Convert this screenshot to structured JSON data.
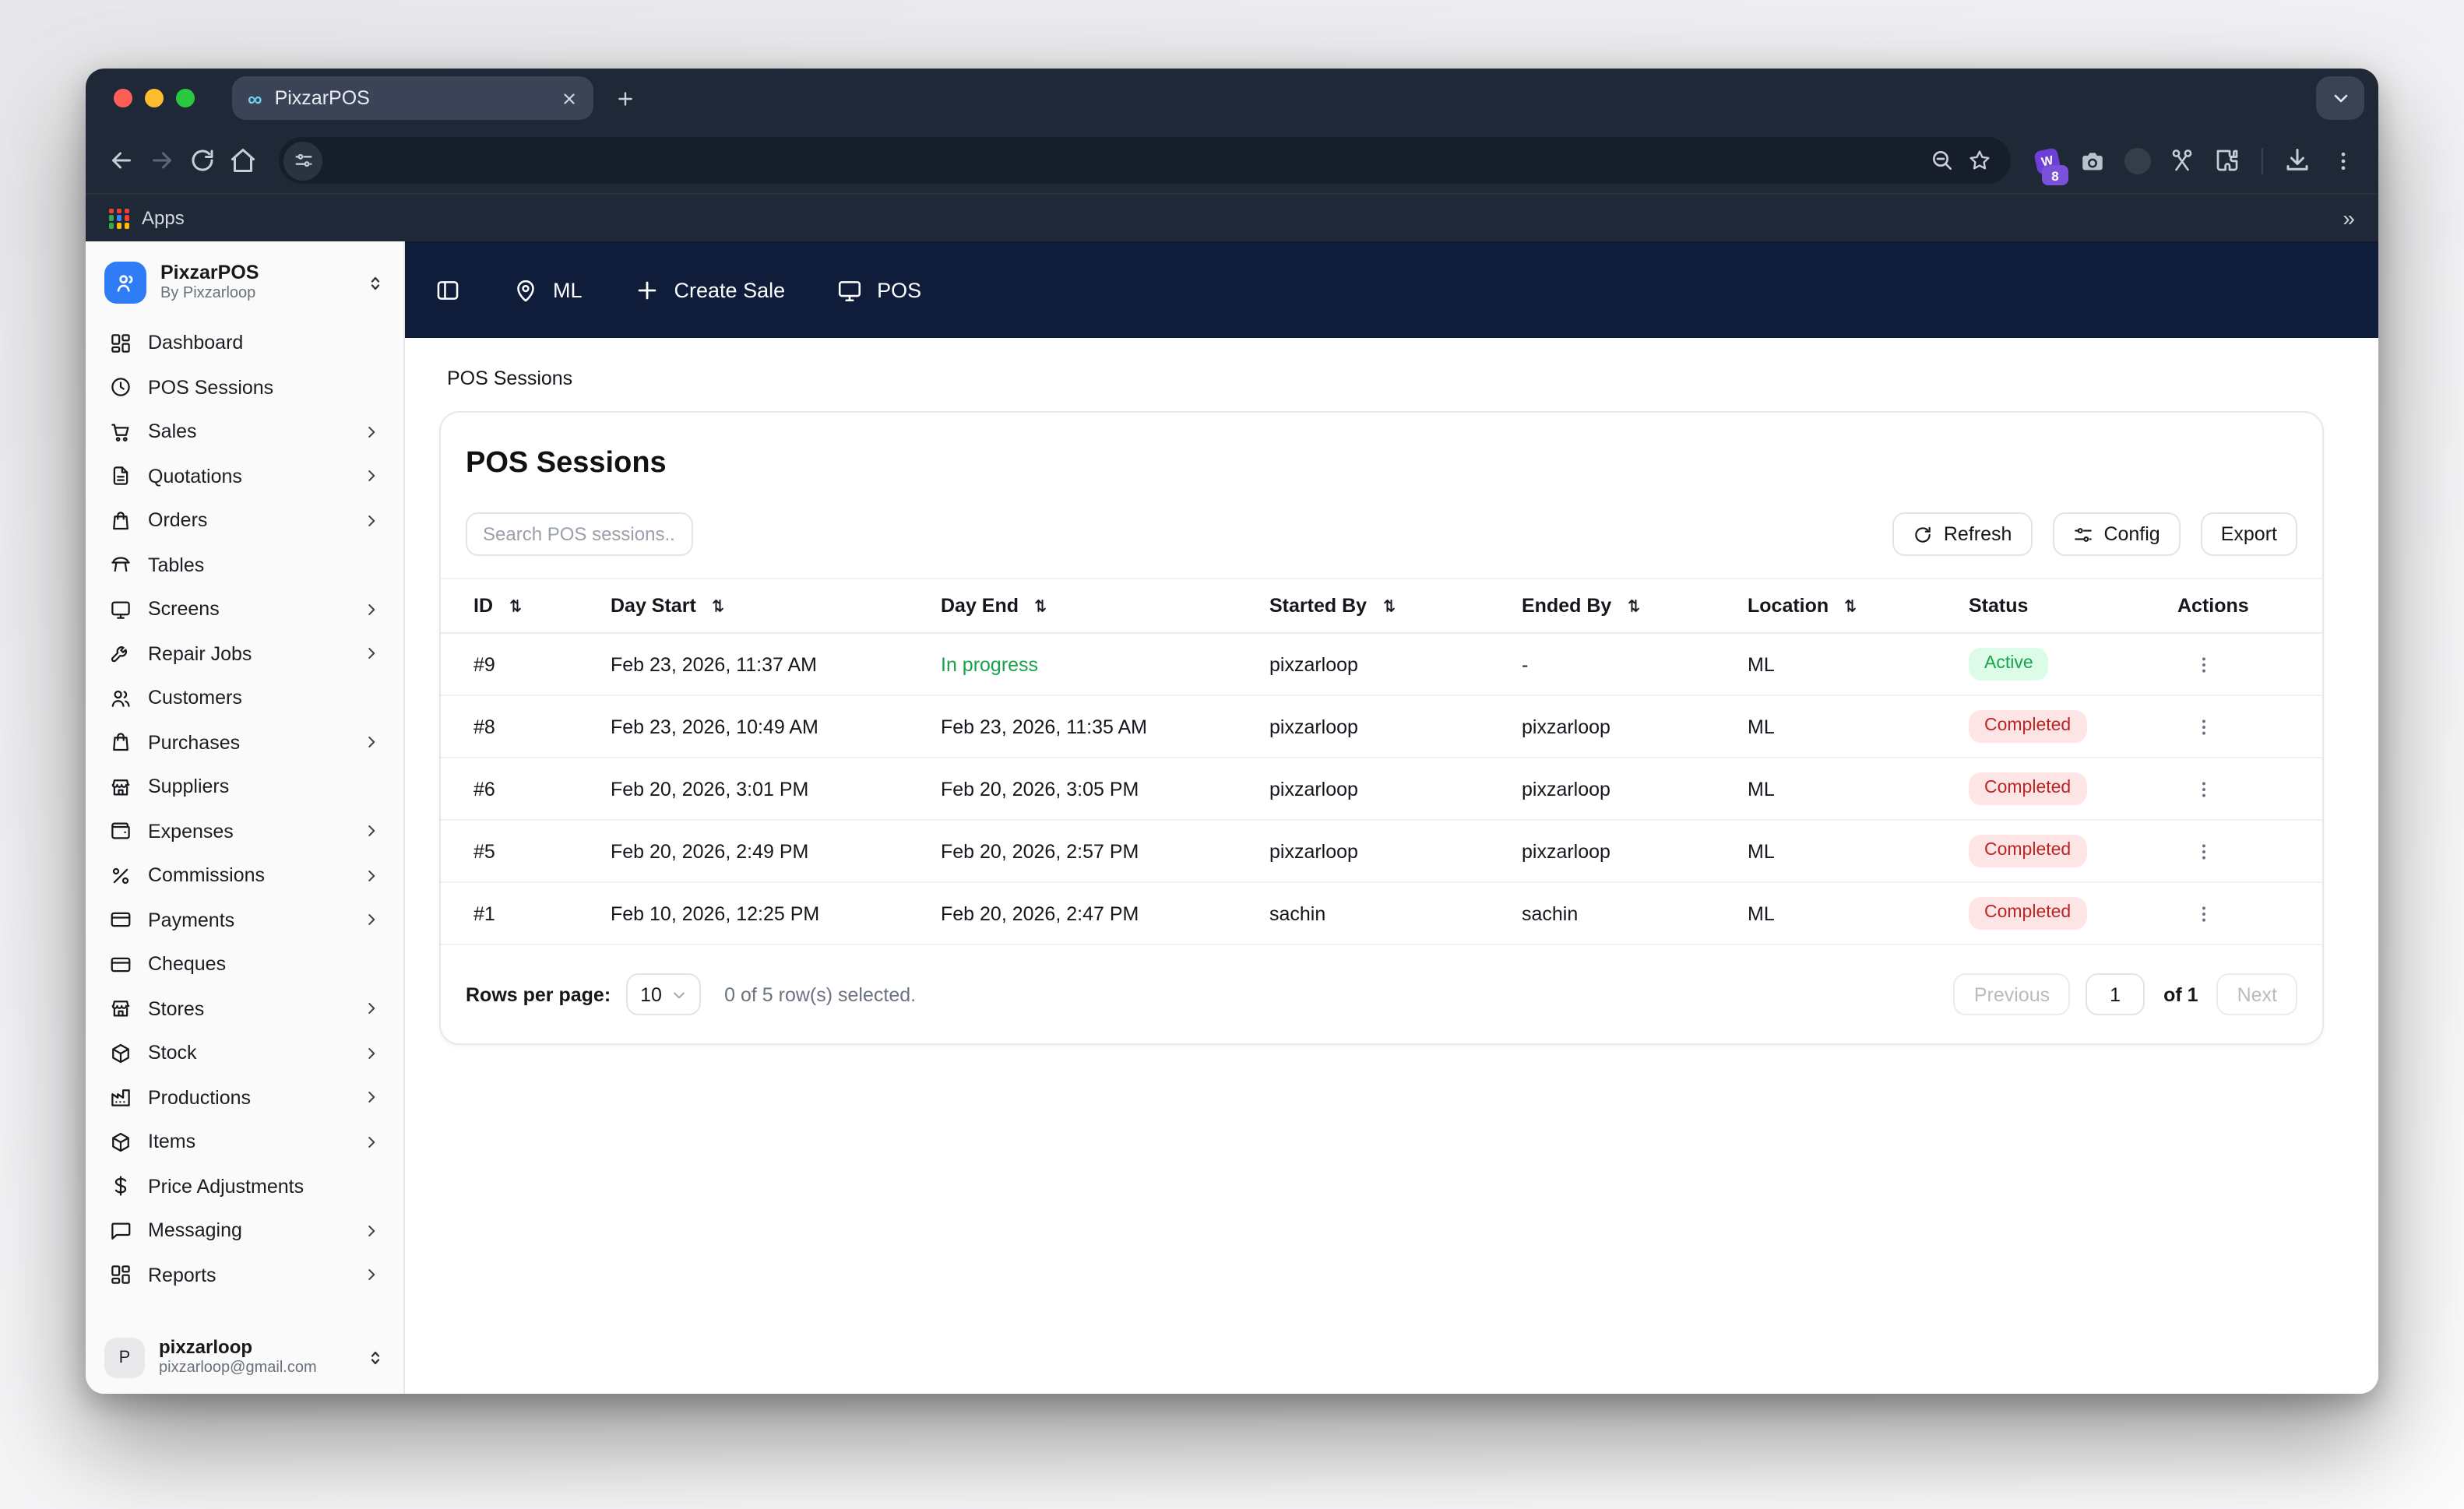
{
  "colors": {
    "navbar_bg": "#0f1d3b",
    "brand_blue": "#2f7df6",
    "active_badge_bg": "#dcfce7",
    "active_badge_text": "#16a34a",
    "completed_badge_bg": "#fde5e5",
    "completed_badge_text": "#bb2525",
    "in_progress_text": "#16a34a"
  },
  "browser": {
    "tab": {
      "title": "PixzarPOS"
    },
    "bookmarks": {
      "apps_label": "Apps",
      "overflow_chevron": "»"
    },
    "extensions": {
      "badge_count": "8"
    }
  },
  "app": {
    "navbar": {
      "location_label": "ML",
      "create_sale_label": "Create Sale",
      "pos_label": "POS"
    },
    "sidebar": {
      "title": "PixzarPOS",
      "subtitle": "By Pixzarloop",
      "items": [
        {
          "label": "Dashboard",
          "icon": "grid-icon",
          "chevron": false
        },
        {
          "label": "POS Sessions",
          "icon": "clock-icon",
          "chevron": false
        },
        {
          "label": "Sales",
          "icon": "cart-icon",
          "chevron": true
        },
        {
          "label": "Quotations",
          "icon": "file-text-icon",
          "chevron": true
        },
        {
          "label": "Orders",
          "icon": "shopping-bag-icon",
          "chevron": true
        },
        {
          "label": "Tables",
          "icon": "table-icon",
          "chevron": false
        },
        {
          "label": "Screens",
          "icon": "monitor-icon",
          "chevron": true
        },
        {
          "label": "Repair Jobs",
          "icon": "wrench-icon",
          "chevron": true
        },
        {
          "label": "Customers",
          "icon": "users-icon",
          "chevron": false
        },
        {
          "label": "Purchases",
          "icon": "shopping-bag-icon",
          "chevron": true
        },
        {
          "label": "Suppliers",
          "icon": "store-icon",
          "chevron": false
        },
        {
          "label": "Expenses",
          "icon": "wallet-icon",
          "chevron": true
        },
        {
          "label": "Commissions",
          "icon": "percent-icon",
          "chevron": true
        },
        {
          "label": "Payments",
          "icon": "credit-card-icon",
          "chevron": true
        },
        {
          "label": "Cheques",
          "icon": "credit-card-icon",
          "chevron": false
        },
        {
          "label": "Stores",
          "icon": "store-icon",
          "chevron": true
        },
        {
          "label": "Stock",
          "icon": "package-icon",
          "chevron": true
        },
        {
          "label": "Productions",
          "icon": "factory-icon",
          "chevron": true
        },
        {
          "label": "Items",
          "icon": "package-icon",
          "chevron": true
        },
        {
          "label": "Price Adjustments",
          "icon": "dollar-icon",
          "chevron": false
        },
        {
          "label": "Messaging",
          "icon": "chat-icon",
          "chevron": true
        },
        {
          "label": "Reports",
          "icon": "grid-icon",
          "chevron": true
        }
      ],
      "user": {
        "name": "pixzarloop",
        "email": "pixzarloop@gmail.com",
        "avatar_initial": "P"
      }
    },
    "breadcrumb": "POS Sessions",
    "page": {
      "title": "POS Sessions",
      "search_placeholder": "Search POS sessions...",
      "refresh_label": "Refresh",
      "config_label": "Config",
      "export_label": "Export",
      "table": {
        "columns": [
          {
            "label": "ID",
            "sortable": true
          },
          {
            "label": "Day Start",
            "sortable": true
          },
          {
            "label": "Day End",
            "sortable": true
          },
          {
            "label": "Started By",
            "sortable": true
          },
          {
            "label": "Ended By",
            "sortable": true
          },
          {
            "label": "Location",
            "sortable": true
          },
          {
            "label": "Status",
            "sortable": false
          },
          {
            "label": "Actions",
            "sortable": false
          }
        ],
        "rows": [
          {
            "id": "#9",
            "day_start": "Feb 23, 2026, 11:37 AM",
            "day_end": "In progress",
            "day_end_in_progress": true,
            "started_by": "pixzarloop",
            "ended_by": "-",
            "location": "ML",
            "status": "Active"
          },
          {
            "id": "#8",
            "day_start": "Feb 23, 2026, 10:49 AM",
            "day_end": "Feb 23, 2026, 11:35 AM",
            "day_end_in_progress": false,
            "started_by": "pixzarloop",
            "ended_by": "pixzarloop",
            "location": "ML",
            "status": "Completed"
          },
          {
            "id": "#6",
            "day_start": "Feb 20, 2026, 3:01 PM",
            "day_end": "Feb 20, 2026, 3:05 PM",
            "day_end_in_progress": false,
            "started_by": "pixzarloop",
            "ended_by": "pixzarloop",
            "location": "ML",
            "status": "Completed"
          },
          {
            "id": "#5",
            "day_start": "Feb 20, 2026, 2:49 PM",
            "day_end": "Feb 20, 2026, 2:57 PM",
            "day_end_in_progress": false,
            "started_by": "pixzarloop",
            "ended_by": "pixzarloop",
            "location": "ML",
            "status": "Completed"
          },
          {
            "id": "#1",
            "day_start": "Feb 10, 2026, 12:25 PM",
            "day_end": "Feb 20, 2026, 2:47 PM",
            "day_end_in_progress": false,
            "started_by": "sachin",
            "ended_by": "sachin",
            "location": "ML",
            "status": "Completed"
          }
        ]
      },
      "footer": {
        "rows_per_page_label": "Rows per page:",
        "rows_per_page_value": "10",
        "selection_text": "0 of 5 row(s) selected.",
        "previous_label": "Previous",
        "page_value": "1",
        "of_label": "of 1",
        "next_label": "Next"
      }
    }
  }
}
